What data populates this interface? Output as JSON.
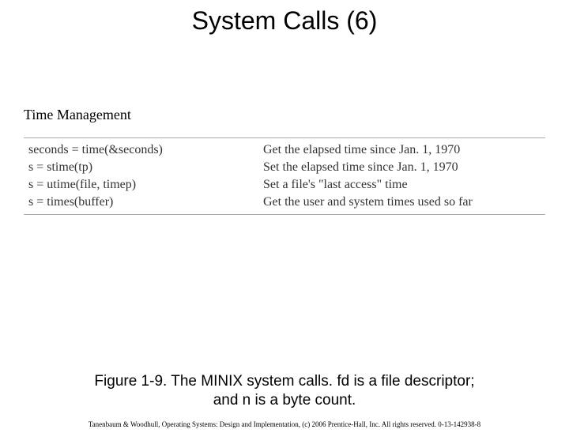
{
  "title": "System Calls (6)",
  "subheading": "Time Management",
  "rows": [
    {
      "call": "seconds = time(&seconds)",
      "desc": "Get the elapsed time since Jan. 1, 1970"
    },
    {
      "call": "s = stime(tp)",
      "desc": "Set the elapsed time since Jan. 1, 1970"
    },
    {
      "call": "s = utime(file, timep)",
      "desc": "Set a file's \"last access\" time"
    },
    {
      "call": "s = times(buffer)",
      "desc": "Get the user and system times used so far"
    }
  ],
  "caption_line1": "Figure 1-9. The MINIX system calls. fd is a file descriptor;",
  "caption_line2": "and n is a byte count.",
  "footer": "Tanenbaum & Woodhull, Operating Systems: Design and Implementation, (c) 2006 Prentice-Hall, Inc. All rights reserved. 0-13-142938-8"
}
